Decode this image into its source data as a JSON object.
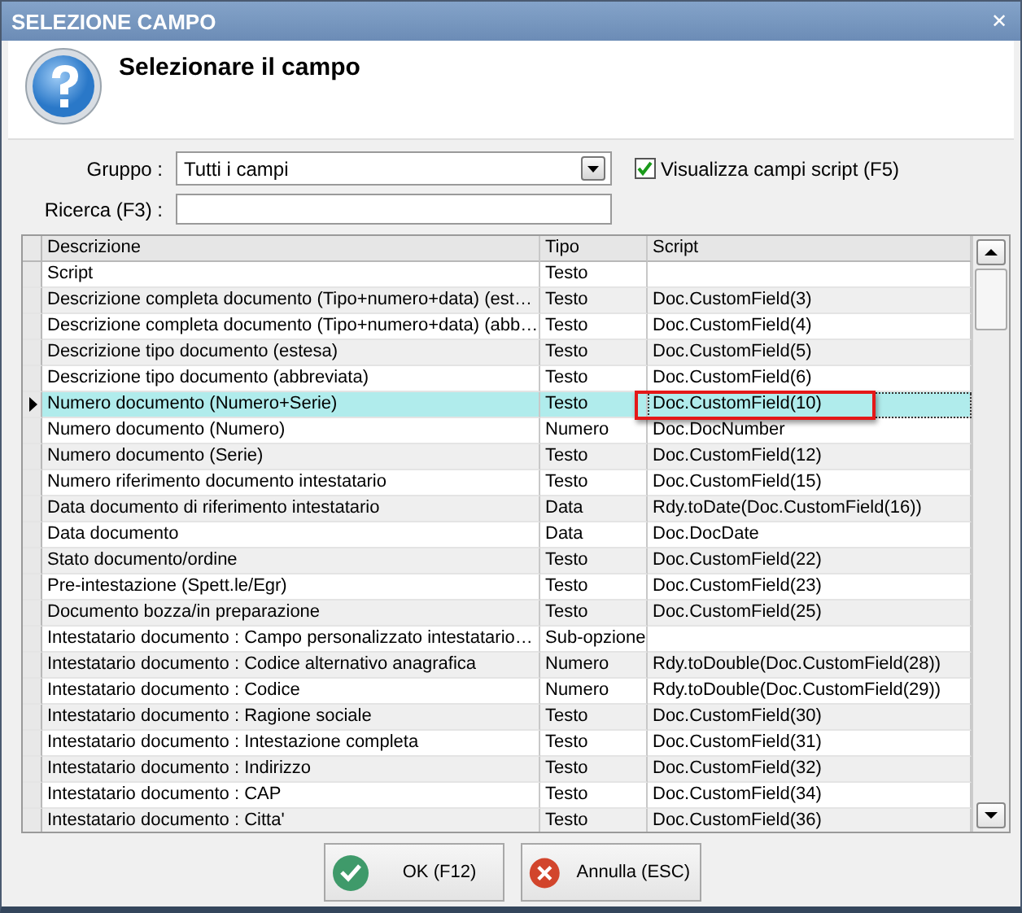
{
  "window": {
    "title": "SELEZIONE CAMPO",
    "close": "✕"
  },
  "header": {
    "title": "Selezionare il campo"
  },
  "form": {
    "group_label": "Gruppo :",
    "group_value": "Tutti i campi",
    "show_scripts": {
      "label": "Visualizza campi script (F5)",
      "checked": true
    },
    "search_label": "Ricerca (F3) :"
  },
  "table": {
    "columns": [
      "Descrizione",
      "Tipo",
      "Script"
    ],
    "rows": [
      {
        "description": "Script",
        "type": "Testo",
        "selected": false,
        "annotated": false
      },
      {
        "description": "Descrizione completa documento (Tipo+numero+data) (est…",
        "type": "Testo",
        "script": "Doc.CustomField(3)",
        "selected": false,
        "annotated": false
      },
      {
        "description": "Descrizione completa documento (Tipo+numero+data) (abb…",
        "type": "Testo",
        "script": "Doc.CustomField(4)",
        "selected": false,
        "annotated": false
      },
      {
        "description": "Descrizione tipo documento (estesa)",
        "type": "Testo",
        "script": "Doc.CustomField(5)",
        "selected": false,
        "annotated": false
      },
      {
        "description": "Descrizione tipo documento (abbreviata)",
        "type": "Testo",
        "script": "Doc.CustomField(6)",
        "selected": false,
        "annotated": false
      },
      {
        "description": "Numero documento (Numero+Serie)",
        "type": "Testo",
        "script": "Doc.CustomField(10)",
        "selected": true,
        "annotated": true
      },
      {
        "description": "Numero documento (Numero)",
        "type": "Numero",
        "script": "Doc.DocNumber",
        "selected": false,
        "annotated": false
      },
      {
        "description": "Numero documento (Serie)",
        "type": "Testo",
        "script": "Doc.CustomField(12)",
        "selected": false,
        "annotated": false
      },
      {
        "description": "Numero riferimento documento intestatario",
        "type": "Testo",
        "script": "Doc.CustomField(15)",
        "selected": false,
        "annotated": false
      },
      {
        "description": "Data documento di riferimento intestatario",
        "type": "Data",
        "script": "Rdy.toDate(Doc.CustomField(16))",
        "selected": false,
        "annotated": false
      },
      {
        "description": "Data documento",
        "type": "Data",
        "script": "Doc.DocDate",
        "selected": false,
        "annotated": false
      },
      {
        "description": "Stato documento/ordine",
        "type": "Testo",
        "script": "Doc.CustomField(22)",
        "selected": false,
        "annotated": false
      },
      {
        "description": "Pre-intestazione (Spett.le/Egr)",
        "type": "Testo",
        "script": "Doc.CustomField(23)",
        "selected": false,
        "annotated": false
      },
      {
        "description": "Documento bozza/in preparazione",
        "type": "Testo",
        "script": "Doc.CustomField(25)",
        "selected": false,
        "annotated": false
      },
      {
        "description": "Intestatario documento : Campo personalizzato intestatario…",
        "type": "Sub-opzione",
        "selected": false,
        "annotated": false
      },
      {
        "description": "Intestatario documento : Codice alternativo anagrafica",
        "type": "Numero",
        "script": "Rdy.toDouble(Doc.CustomField(28))",
        "selected": false,
        "annotated": false
      },
      {
        "description": "Intestatario documento : Codice",
        "type": "Numero",
        "script": "Rdy.toDouble(Doc.CustomField(29))",
        "selected": false,
        "annotated": false
      },
      {
        "description": "Intestatario documento : Ragione sociale",
        "type": "Testo",
        "script": "Doc.CustomField(30)",
        "selected": false,
        "annotated": false
      },
      {
        "description": "Intestatario documento : Intestazione completa",
        "type": "Testo",
        "script": "Doc.CustomField(31)",
        "selected": false,
        "annotated": false
      },
      {
        "description": "Intestatario documento : Indirizzo",
        "type": "Testo",
        "script": "Doc.CustomField(32)",
        "selected": false,
        "annotated": false
      },
      {
        "description": "Intestatario documento : CAP",
        "type": "Testo",
        "script": "Doc.CustomField(34)",
        "selected": false,
        "annotated": false
      },
      {
        "description": "Intestatario documento : Citta'",
        "type": "Testo",
        "script": "Doc.CustomField(36)",
        "selected": false,
        "annotated": false
      }
    ]
  },
  "buttons": [
    {
      "kind": "ok",
      "label": "OK (F12)"
    },
    {
      "kind": "cancel",
      "label": "Annulla (ESC)"
    }
  ]
}
